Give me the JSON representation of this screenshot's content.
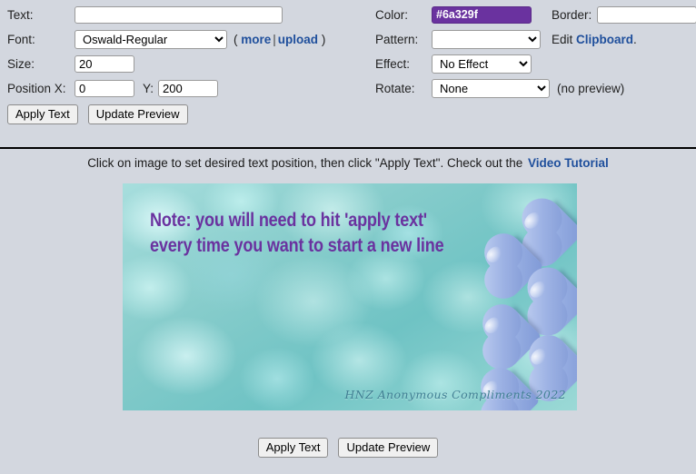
{
  "controls": {
    "left": {
      "text": {
        "label": "Text:",
        "value": "",
        "placeholder": ""
      },
      "font": {
        "label": "Font:",
        "value": "Oswald-Regular",
        "options": [
          "Oswald-Regular"
        ],
        "more_label": "more",
        "separator": "|",
        "upload_label": "upload",
        "open_paren": "(",
        "close_paren": ")"
      },
      "size": {
        "label": "Size:",
        "value": "20"
      },
      "position": {
        "label_x": "Position X:",
        "value_x": "0",
        "label_y": "Y:",
        "value_y": "200"
      }
    },
    "right": {
      "color": {
        "label": "Color:",
        "value": "#6a329f",
        "swatch_hex": "#6a329f",
        "text_hex": "#ffffff"
      },
      "border": {
        "label": "Border:",
        "value": "",
        "placeholder": ""
      },
      "pattern": {
        "label": "Pattern:",
        "value": "",
        "options": [
          ""
        ]
      },
      "clipboard": {
        "edit_label": "Edit",
        "link_label": "Clipboard",
        "period": "."
      },
      "effect": {
        "label": "Effect:",
        "value": "No Effect",
        "options": [
          "No Effect"
        ]
      },
      "rotate": {
        "label": "Rotate:",
        "value": "None",
        "options": [
          "None"
        ],
        "note": "(no preview)"
      }
    }
  },
  "buttons": {
    "apply_text": "Apply Text",
    "update_preview": "Update Preview"
  },
  "instruction": {
    "text": "Click on image to set desired text position, then click \"Apply Text\". Check out the",
    "link_label": "Video Tutorial"
  },
  "preview": {
    "overlay_line_1": "Note: you will need to hit 'apply text'",
    "overlay_line_2": "every time you want to start a new line",
    "overlay_color": "#6a329f",
    "watermark": "HNZ Anonymous Compliments 2022",
    "watermark_color": "#3f7f93",
    "heart_color": "#93a9e0",
    "background_color": "#8fd3d0"
  },
  "theme": {
    "page_background": "#d3d7df",
    "link_color": "#1f4f9c",
    "divider_color": "#000000"
  }
}
